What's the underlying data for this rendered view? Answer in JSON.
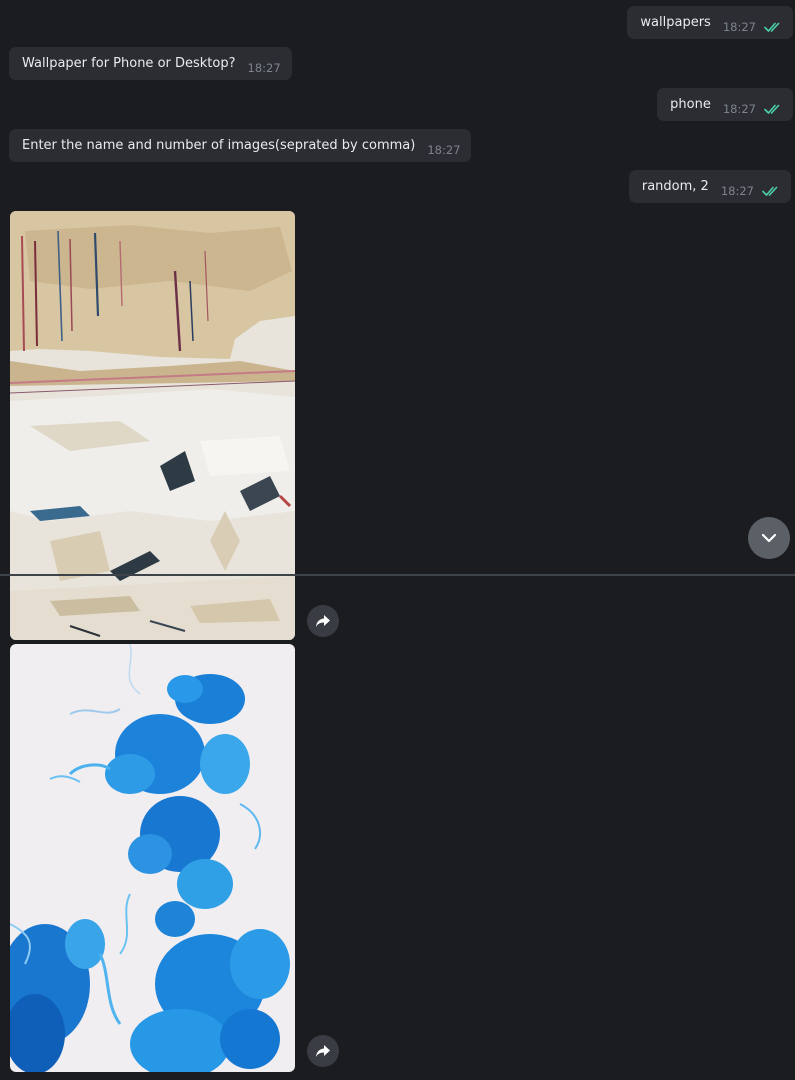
{
  "messages": [
    {
      "direction": "out",
      "text": "wallpapers",
      "time": "18:27",
      "status": "read"
    },
    {
      "direction": "in",
      "text": "Wallpaper for Phone or Desktop?",
      "time": "18:27"
    },
    {
      "direction": "out",
      "text": "phone",
      "time": "18:27",
      "status": "read"
    },
    {
      "direction": "in",
      "text": "Enter the name and number of images(seprated by comma)",
      "time": "18:27"
    },
    {
      "direction": "out",
      "text": "random, 2",
      "time": "18:27",
      "status": "read"
    }
  ],
  "photos": [
    {
      "subject": "textured cream and white oil paint strokes with red and blue streaks"
    },
    {
      "subject": "blue ink swirling in water on white background"
    }
  ],
  "icons": {
    "read_check": "double-check-icon",
    "share": "share-arrow-icon",
    "scroll_down": "chevron-down-icon"
  },
  "colors": {
    "background": "#1b1c20",
    "bubble": "#2b2d33",
    "text": "#e9ebee",
    "time": "#7d838c",
    "read_check": "#4cd1a6"
  }
}
